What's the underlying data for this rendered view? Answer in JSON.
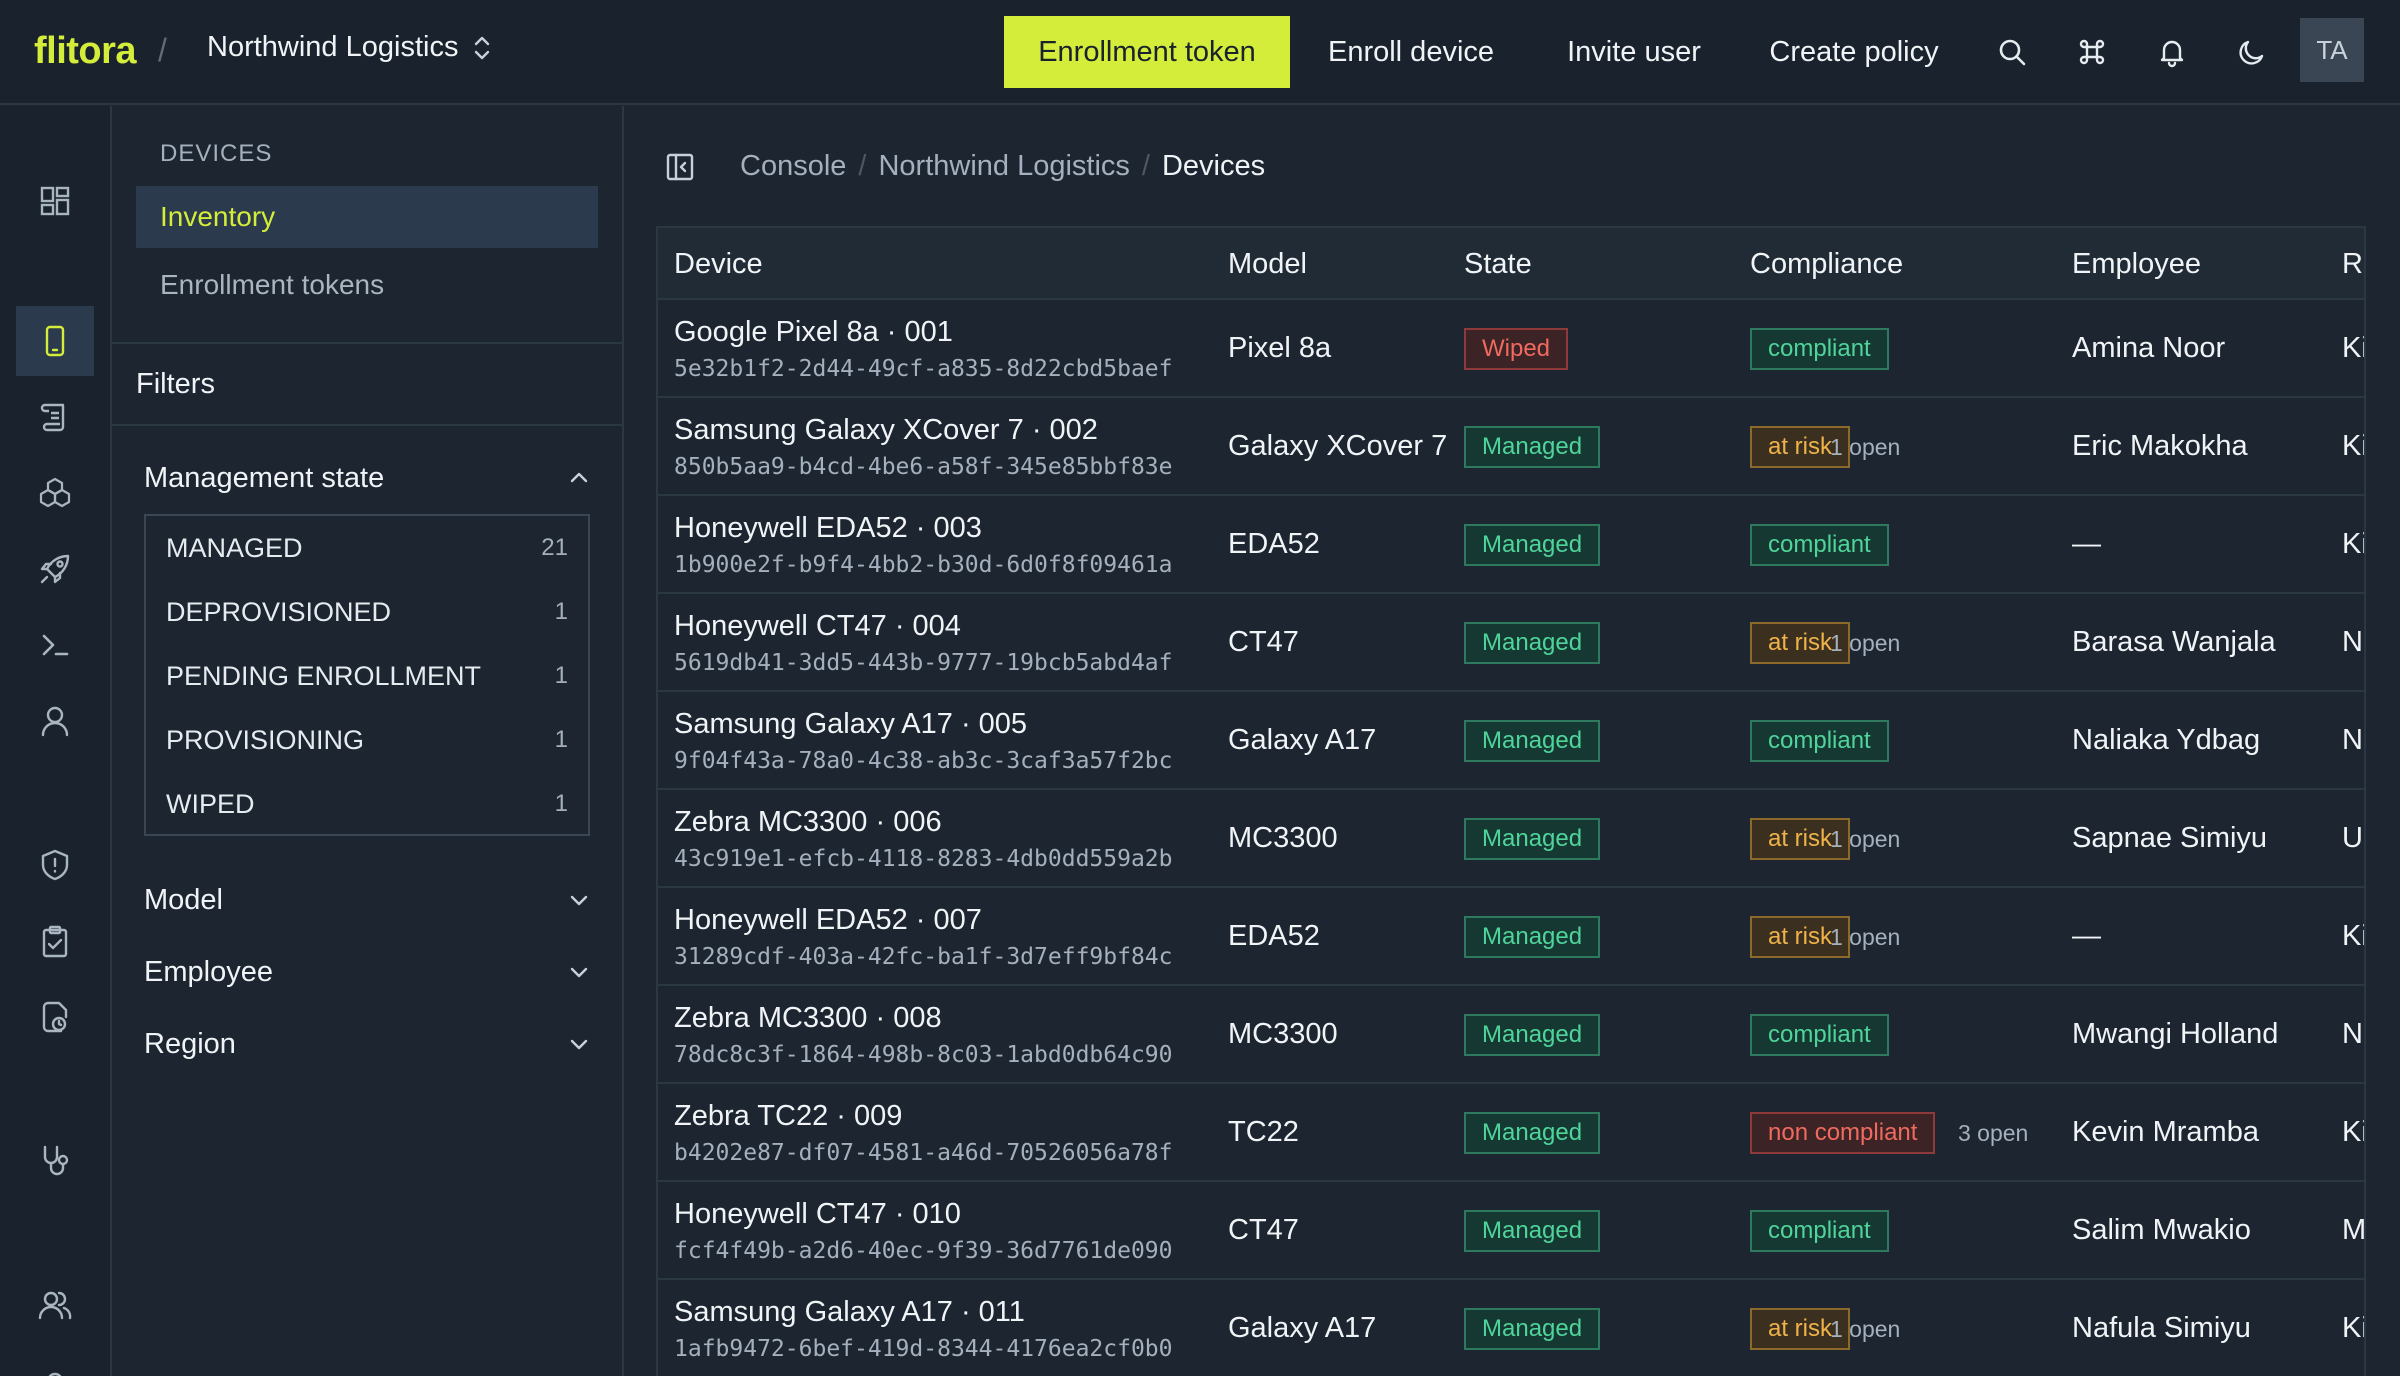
{
  "brand": {
    "logo": "flitora",
    "separator": "/",
    "org": "Northwind Logistics"
  },
  "topbar": {
    "enrollment_token": "Enrollment token",
    "enroll_device": "Enroll device",
    "invite_user": "Invite user",
    "create_policy": "Create policy",
    "avatar": "TA"
  },
  "rail": [
    "dashboard-icon",
    "device-icon",
    "scroll-icon",
    "cubes-icon",
    "rocket-icon",
    "terminal-icon",
    "user-icon",
    "shield-icon",
    "clipboard-icon",
    "history-icon",
    "stethoscope-icon",
    "users-icon"
  ],
  "sidebar": {
    "section": "DEVICES",
    "items": [
      {
        "label": "Inventory"
      },
      {
        "label": "Enrollment tokens"
      }
    ],
    "filters_title": "Filters",
    "facets": [
      {
        "label": "Management state"
      },
      {
        "label": "Model"
      },
      {
        "label": "Employee"
      },
      {
        "label": "Region"
      }
    ],
    "states": [
      {
        "label": "MANAGED",
        "count": "21"
      },
      {
        "label": "DEPROVISIONED",
        "count": "1"
      },
      {
        "label": "PENDING ENROLLMENT",
        "count": "1"
      },
      {
        "label": "PROVISIONING",
        "count": "1"
      },
      {
        "label": "WIPED",
        "count": "1"
      }
    ]
  },
  "breadcrumb": {
    "c1": "Console",
    "c2": "Northwind Logistics",
    "c3": "Devices",
    "sep": "/"
  },
  "table": {
    "columns": [
      "Device",
      "Model",
      "State",
      "Compliance",
      "Employee",
      "Region"
    ],
    "rows": [
      {
        "name": "Google Pixel 8a · 001",
        "id": "5e32b1f2-2d44-49cf-a835-8d22cbd5baef",
        "model": "Pixel 8a",
        "state": "Wiped",
        "compliance": "compliant",
        "open": "",
        "employee": "Amina Noor",
        "region": "Ki"
      },
      {
        "name": "Samsung Galaxy XCover 7 · 002",
        "id": "850b5aa9-b4cd-4be6-a58f-345e85bbf83e",
        "model": "Galaxy XCover 7",
        "state": "Managed",
        "compliance": "at risk",
        "open": "1 open",
        "employee": "Eric Makokha",
        "region": "Ki"
      },
      {
        "name": "Honeywell EDA52 · 003",
        "id": "1b900e2f-b9f4-4bb2-b30d-6d0f8f09461a",
        "model": "EDA52",
        "state": "Managed",
        "compliance": "compliant",
        "open": "",
        "employee": "—",
        "region": "Ki"
      },
      {
        "name": "Honeywell CT47 · 004",
        "id": "5619db41-3dd5-443b-9777-19bcb5abd4af",
        "model": "CT47",
        "state": "Managed",
        "compliance": "at risk",
        "open": "1 open",
        "employee": "Barasa Wanjala",
        "region": "N"
      },
      {
        "name": "Samsung Galaxy A17 · 005",
        "id": "9f04f43a-78a0-4c38-ab3c-3caf3a57f2bc",
        "model": "Galaxy A17",
        "state": "Managed",
        "compliance": "compliant",
        "open": "",
        "employee": "Naliaka Ydbag",
        "region": "N"
      },
      {
        "name": "Zebra MC3300 · 006",
        "id": "43c919e1-efcb-4118-8283-4db0dd559a2b",
        "model": "MC3300",
        "state": "Managed",
        "compliance": "at risk",
        "open": "1 open",
        "employee": "Sapnae Simiyu",
        "region": "U"
      },
      {
        "name": "Honeywell EDA52 · 007",
        "id": "31289cdf-403a-42fc-ba1f-3d7eff9bf84c",
        "model": "EDA52",
        "state": "Managed",
        "compliance": "at risk",
        "open": "1 open",
        "employee": "—",
        "region": "Ki"
      },
      {
        "name": "Zebra MC3300 · 008",
        "id": "78dc8c3f-1864-498b-8c03-1abd0db64c90",
        "model": "MC3300",
        "state": "Managed",
        "compliance": "compliant",
        "open": "",
        "employee": "Mwangi Holland",
        "region": "N"
      },
      {
        "name": "Zebra TC22 · 009",
        "id": "b4202e87-df07-4581-a46d-70526056a78f",
        "model": "TC22",
        "state": "Managed",
        "compliance": "non compliant",
        "open": "3 open",
        "employee": "Kevin Mramba",
        "region": "Ki"
      },
      {
        "name": "Honeywell CT47 · 010",
        "id": "fcf4f49b-a2d6-40ec-9f39-36d7761de090",
        "model": "CT47",
        "state": "Managed",
        "compliance": "compliant",
        "open": "",
        "employee": "Salim Mwakio",
        "region": "M"
      },
      {
        "name": "Samsung Galaxy A17 · 011",
        "id": "1afb9472-6bef-419d-8344-4176ea2cf0b0",
        "model": "Galaxy A17",
        "state": "Managed",
        "compliance": "at risk",
        "open": "1 open",
        "employee": "Nafula Simiyu",
        "region": "Ki"
      }
    ]
  },
  "colors": {
    "accent": "#d4ec3a",
    "managed": "#4fd49a",
    "at_risk": "#f0b34a",
    "danger": "#f06a5e"
  }
}
